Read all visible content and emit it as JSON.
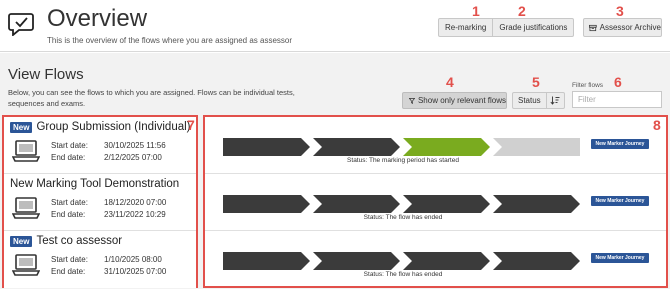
{
  "header": {
    "title": "Overview",
    "subtitle": "This is the overview of the flows where you are assigned as assessor",
    "remarking_label": "Re-marking",
    "grade_justifications_label": "Grade justifications",
    "assessor_archive_label": "Assessor Archive"
  },
  "annotations": [
    "1",
    "2",
    "3",
    "4",
    "5",
    "6",
    "7",
    "8"
  ],
  "section": {
    "title": "View Flows",
    "description": "Below, you can see the flows to which you are assigned. Flows can be individual tests, sequences and exams."
  },
  "toolbar": {
    "relevant_label": "Show only relevant flows",
    "status_label": "Status",
    "filter_label": "Filter flows",
    "filter_placeholder": "Filter"
  },
  "flows": [
    {
      "is_new": true,
      "new_label": "New",
      "title": "Group Submission (Individual)",
      "start_label": "Start date:",
      "start_date": "30/10/2025 11:56",
      "end_label": "End date:",
      "end_date": "2/12/2025 07:00",
      "status": "Status: The marking period has started",
      "stages": [
        "done",
        "done",
        "active",
        "pending"
      ],
      "marker_label": "New Marker Journey"
    },
    {
      "is_new": false,
      "new_label": "",
      "title": "New Marking Tool Demonstration",
      "start_label": "Start date:",
      "start_date": "18/12/2020 07:00",
      "end_label": "End date:",
      "end_date": "23/11/2022 10:29",
      "status": "Status: The flow has ended",
      "stages": [
        "done",
        "done",
        "done",
        "done"
      ],
      "marker_label": "New Marker Journey"
    },
    {
      "is_new": true,
      "new_label": "New",
      "title": "Test co assessor",
      "start_label": "Start date:",
      "start_date": "1/10/2025 08:00",
      "end_label": "End date:",
      "end_date": "31/10/2025 07:00",
      "status": "Status: The flow has ended",
      "stages": [
        "done",
        "done",
        "done",
        "done"
      ],
      "marker_label": "New Marker Journey"
    }
  ],
  "colors": {
    "accent_blue": "#2b5597",
    "annotation_red": "#e2504b",
    "stage_done": "#3b3b3b",
    "stage_active": "#7aab1f",
    "stage_pending": "#d0d0d0"
  },
  "icons": {
    "logo": "speech-bubble-check-icon",
    "archive": "archive-box-icon",
    "filter": "funnel-icon",
    "sort": "sort-icon",
    "flow": "laptop-icon"
  }
}
